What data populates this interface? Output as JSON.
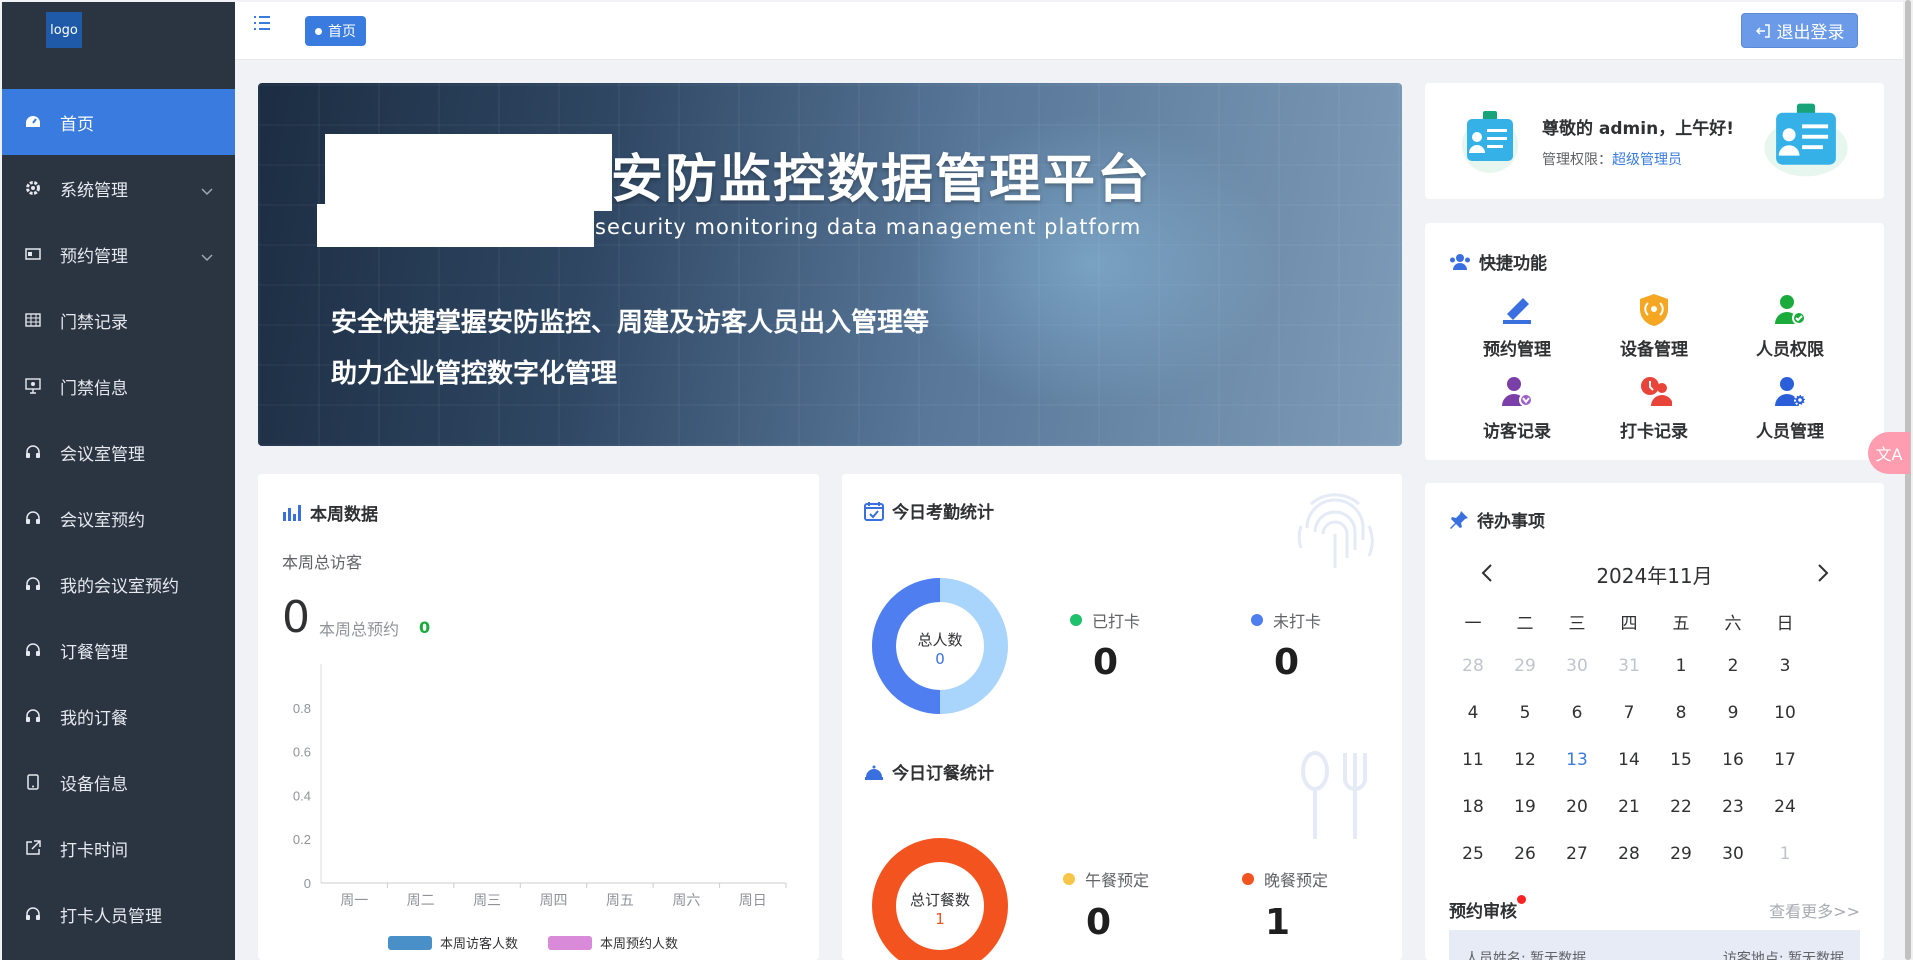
{
  "logo": "logo",
  "sidebar": {
    "items": [
      {
        "label": "首页"
      },
      {
        "label": "系统管理"
      },
      {
        "label": "预约管理"
      },
      {
        "label": "门禁记录"
      },
      {
        "label": "门禁信息"
      },
      {
        "label": "会议室管理"
      },
      {
        "label": "会议室预约"
      },
      {
        "label": "我的会议室预约"
      },
      {
        "label": "订餐管理"
      },
      {
        "label": "我的订餐"
      },
      {
        "label": "设备信息"
      },
      {
        "label": "打卡时间"
      },
      {
        "label": "打卡人员管理"
      }
    ]
  },
  "header": {
    "breadcrumb": "首页",
    "logout": "退出登录"
  },
  "banner": {
    "title": "安防监控数据管理平台",
    "subtitle": "security monitoring data management platform",
    "line1": "安全快捷掌握安防监控、周建及访客人员出入管理等",
    "line2": "助力企业管控数字化管理"
  },
  "welcome": {
    "greeting": "尊敬的 admin，上午好!",
    "perm_label": "管理权限：",
    "perm_value": "超级管理员"
  },
  "quick": {
    "title": "快捷功能",
    "items": [
      {
        "label": "预约管理",
        "icon": "appointment-icon",
        "color": "#3a6fe0"
      },
      {
        "label": "设备管理",
        "icon": "device-shield-icon",
        "color": "#f5a623"
      },
      {
        "label": "人员权限",
        "icon": "user-permission-icon",
        "color": "#1aab3c"
      },
      {
        "label": "访客记录",
        "icon": "visitor-icon",
        "color": "#7b3fa8"
      },
      {
        "label": "打卡记录",
        "icon": "clockin-icon",
        "color": "#e8443a"
      },
      {
        "label": "人员管理",
        "icon": "user-manage-icon",
        "color": "#2b5fd9"
      }
    ]
  },
  "week": {
    "title": "本周数据",
    "total_visitors_label": "本周总访客",
    "total_visitors": "0",
    "total_booking_label": "本周总预约",
    "total_booking": "0"
  },
  "chart_data": {
    "type": "bar",
    "categories": [
      "周一",
      "周二",
      "周三",
      "周四",
      "周五",
      "周六",
      "周日"
    ],
    "series": [
      {
        "name": "本周访客人数",
        "values": [
          0,
          0,
          0,
          0,
          0,
          0,
          0
        ],
        "color": "#4a90c8"
      },
      {
        "name": "本周预约人数",
        "values": [
          0,
          0,
          0,
          0,
          0,
          0,
          0
        ],
        "color": "#d98ad8"
      }
    ],
    "yticks": [
      "0",
      "0.2",
      "0.4",
      "0.6",
      "0.8"
    ],
    "ylim": [
      0,
      1
    ],
    "legend": "bottom"
  },
  "attendance": {
    "title": "今日考勤统计",
    "donut_label": "总人数",
    "donut_value": "0",
    "checked_label": "已打卡",
    "checked_value": "0",
    "unchecked_label": "未打卡",
    "unchecked_value": "0",
    "colors": {
      "checked": "#1fc16b",
      "unchecked": "#4f7ef0"
    }
  },
  "meal": {
    "title": "今日订餐统计",
    "donut_label": "总订餐数",
    "donut_value": "1",
    "lunch_label": "午餐预定",
    "lunch_value": "0",
    "dinner_label": "晚餐预定",
    "dinner_value": "1",
    "colors": {
      "lunch": "#f7c548",
      "dinner": "#f3541f"
    }
  },
  "todo": {
    "title": "待办事项",
    "month": "2024年11月",
    "weekdays": [
      "一",
      "二",
      "三",
      "四",
      "五",
      "六",
      "日"
    ],
    "days": [
      [
        "28",
        "29",
        "30",
        "31",
        "1",
        "2",
        "3"
      ],
      [
        "4",
        "5",
        "6",
        "7",
        "8",
        "9",
        "10"
      ],
      [
        "11",
        "12",
        "13",
        "14",
        "15",
        "16",
        "17"
      ],
      [
        "18",
        "19",
        "20",
        "21",
        "22",
        "23",
        "24"
      ],
      [
        "25",
        "26",
        "27",
        "28",
        "29",
        "30",
        "1"
      ]
    ],
    "review_title": "预约审核",
    "more": "查看更多>>",
    "row_name": "人员姓名: 暂无数据",
    "row_place": "访客地点: 暂无数据"
  },
  "translate": "文A"
}
